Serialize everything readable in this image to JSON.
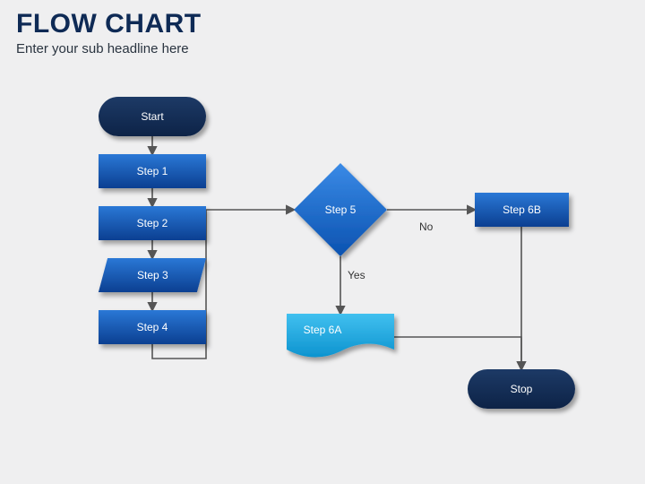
{
  "header": {
    "title": "FLOW CHART",
    "subtitle": "Enter your sub headline here"
  },
  "nodes": {
    "start": "Start",
    "step1": "Step 1",
    "step2": "Step 2",
    "step3": "Step 3",
    "step4": "Step 4",
    "step5": "Step 5",
    "step6a": "Step 6A",
    "step6b": "Step 6B",
    "stop": "Stop"
  },
  "edges": {
    "yes": "Yes",
    "no": "No"
  },
  "colors": {
    "dark_blue": "#12325e",
    "mid_blue": "#1558b0",
    "bright": "#1fa8e0",
    "arrow": "#555555"
  }
}
